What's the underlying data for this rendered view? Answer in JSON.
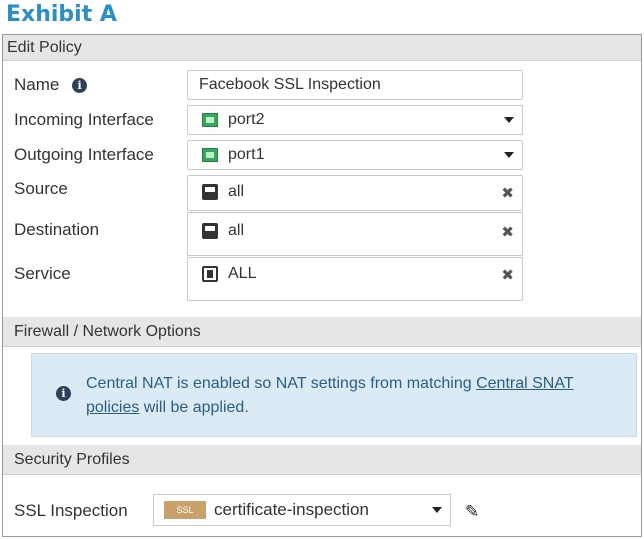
{
  "exhibit_title": "Exhibit A",
  "dialog_title": "Edit Policy",
  "fields": {
    "name": {
      "label": "Name",
      "value": "Facebook SSL Inspection"
    },
    "incoming": {
      "label": "Incoming Interface",
      "value": "port2"
    },
    "outgoing": {
      "label": "Outgoing Interface",
      "value": "port1"
    },
    "source": {
      "label": "Source",
      "value": "all"
    },
    "destination": {
      "label": "Destination",
      "value": "all"
    },
    "service": {
      "label": "Service",
      "value": "ALL"
    }
  },
  "firewall_section": {
    "title": "Firewall / Network Options",
    "message_prefix": "Central NAT is enabled so NAT settings from matching ",
    "link_text": "Central SNAT policies",
    "message_suffix": " will be applied."
  },
  "security_section": {
    "title": "Security Profiles",
    "ssl_label": "SSL Inspection",
    "ssl_badge": "SSL",
    "ssl_value": "certificate-inspection"
  },
  "icons": {
    "info": "info-icon",
    "interface": "interface-icon",
    "address": "address-icon",
    "service": "service-icon",
    "remove": "remove-icon",
    "edit": "pencil-icon"
  }
}
